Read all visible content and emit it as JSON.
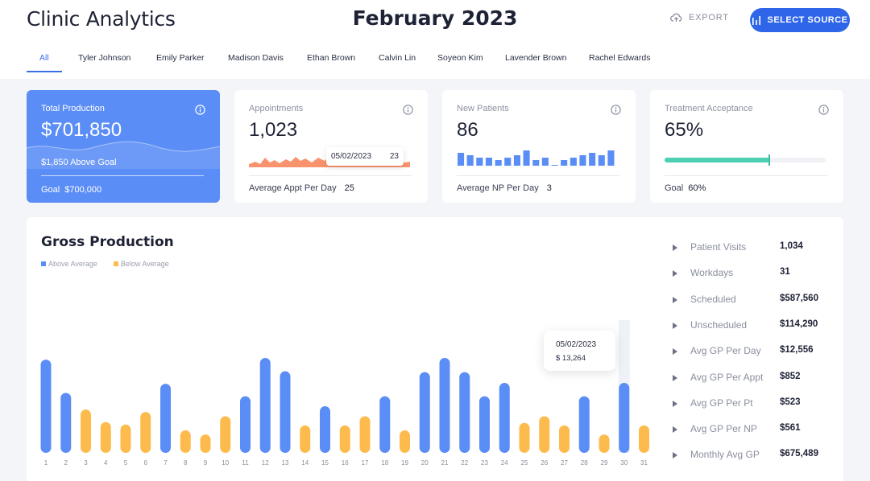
{
  "header": {
    "app_title": "Clinic Analytics",
    "month": "February 2023",
    "export_label": "EXPORT",
    "select_source_label": "SELECT SOURCE"
  },
  "tabs": [
    "All",
    "Tyler Johnson",
    "Emily Parker",
    "Madison Davis",
    "Ethan Brown",
    "Calvin Lin",
    "Soyeon Kim",
    "Lavender Brown",
    "Rachel Edwards"
  ],
  "cards": {
    "production": {
      "label": "Total Production",
      "value": "$701,850",
      "above_goal": "$1,850 Above Goal",
      "goal_label": "Goal",
      "goal_value": "$700,000"
    },
    "appointments": {
      "label": "Appointments",
      "value": "1,023",
      "tooltip_date": "05/02/2023",
      "tooltip_value": "23",
      "footer_label": "Average Appt Per Day",
      "footer_value": "25"
    },
    "new_patients": {
      "label": "New Patients",
      "value": "86",
      "footer_label": "Average NP Per Day",
      "footer_value": "3",
      "bars": [
        4,
        3,
        2,
        2,
        1,
        2,
        3,
        5,
        1,
        2,
        0,
        1,
        2,
        3,
        4,
        3,
        5
      ]
    },
    "treatment": {
      "label": "Treatment Acceptance",
      "value": "65%",
      "progress": 0.65,
      "goal_fraction": 0.6,
      "footer_label": "Goal",
      "footer_value": "60%"
    }
  },
  "gross": {
    "title": "Gross Production",
    "legend": {
      "above": "Above Average",
      "below": "Below Average"
    },
    "tooltip_date": "05/02/2023",
    "tooltip_value": "$ 13,264",
    "stats": [
      {
        "label": "Patient Visits",
        "value": "1,034"
      },
      {
        "label": "Workdays",
        "value": "31"
      },
      {
        "label": "Scheduled",
        "value": "$587,560"
      },
      {
        "label": "Unscheduled",
        "value": "$114,290"
      },
      {
        "label": "Avg GP Per Day",
        "value": "$12,556"
      },
      {
        "label": "Avg GP Per Appt",
        "value": "$852"
      },
      {
        "label": "Avg GP Per Pt",
        "value": "$523"
      },
      {
        "label": "Avg GP Per NP",
        "value": "$561"
      },
      {
        "label": "Monthly Avg GP",
        "value": "$675,489"
      }
    ]
  },
  "chart_data": {
    "type": "bar",
    "title": "Gross Production",
    "categories": [
      "1",
      "2",
      "3",
      "4",
      "5",
      "6",
      "7",
      "8",
      "9",
      "10",
      "11",
      "12",
      "13",
      "14",
      "15",
      "16",
      "17",
      "18",
      "19",
      "20",
      "21",
      "22",
      "23",
      "24",
      "25",
      "26",
      "27",
      "28",
      "29",
      "30",
      "31"
    ],
    "values": [
      112,
      72,
      52,
      37,
      34,
      49,
      83,
      27,
      22,
      44,
      68,
      114,
      98,
      33,
      56,
      33,
      44,
      68,
      27,
      97,
      114,
      97,
      68,
      84,
      36,
      44,
      33,
      68,
      22,
      84,
      33
    ],
    "above_average": [
      true,
      true,
      false,
      false,
      false,
      false,
      true,
      false,
      false,
      false,
      true,
      true,
      true,
      false,
      true,
      false,
      false,
      true,
      false,
      true,
      true,
      true,
      true,
      true,
      false,
      false,
      false,
      true,
      false,
      true,
      false
    ],
    "colors": {
      "above": "#5b8df6",
      "below": "#fdbb4d"
    },
    "highlight_index": 29
  },
  "colors": {
    "accent": "#2f66e9",
    "primary_card": "#5b8df6",
    "appt_area": "#f9936e",
    "np_bars": "#5b8df6",
    "progress": "#4ccfb3"
  }
}
